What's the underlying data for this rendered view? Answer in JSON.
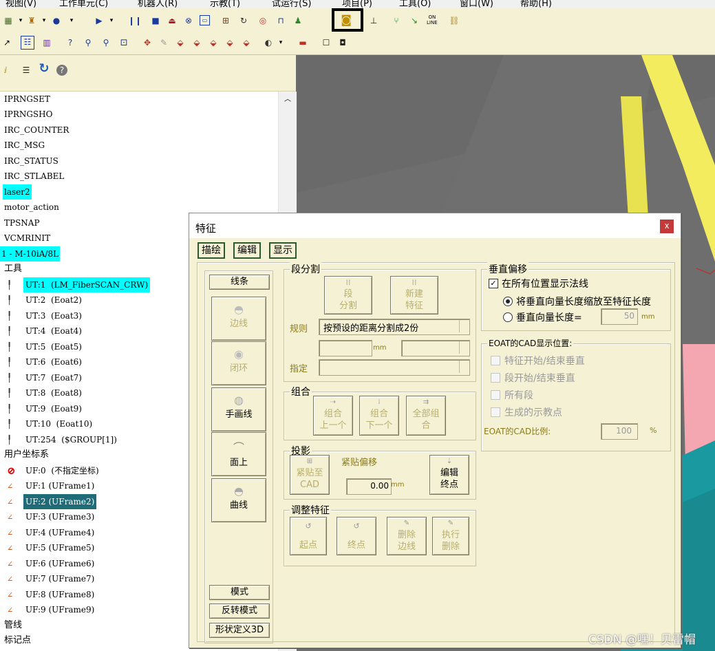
{
  "menubar": {
    "items": [
      "视图(V)",
      "工作单元(C)",
      "机器人(R)",
      "示教(T)",
      "试运行(S)",
      "项目(P)",
      "工具(O)",
      "窗口(W)",
      "帮助(H)"
    ]
  },
  "toolbar": {
    "online_label_1": "ON",
    "online_label_2": "LINE"
  },
  "tree": {
    "items": [
      {
        "text": "IPRNGSET",
        "hl": ""
      },
      {
        "text": "IPRNGSHO",
        "hl": ""
      },
      {
        "text": "IRC_COUNTER",
        "hl": ""
      },
      {
        "text": "IRC_MSG",
        "hl": ""
      },
      {
        "text": "IRC_STATUS",
        "hl": ""
      },
      {
        "text": "IRC_STLABEL",
        "hl": ""
      },
      {
        "text": "laser2",
        "hl": "cyan"
      },
      {
        "text": "motor_action",
        "hl": ""
      },
      {
        "text": "TPSNAP",
        "hl": ""
      },
      {
        "text": "VCMRINIT",
        "hl": ""
      },
      {
        "text": "1 - M-10iA/8L",
        "hl": "cyan"
      },
      {
        "text": "工具",
        "hl": ""
      },
      {
        "text": "UT:1  (LM_FiberSCAN_CRW)",
        "hl": "cyan"
      },
      {
        "text": "UT:2  (Eoat2)",
        "hl": ""
      },
      {
        "text": "UT:3  (Eoat3)",
        "hl": ""
      },
      {
        "text": "UT:4  (Eoat4)",
        "hl": ""
      },
      {
        "text": "UT:5  (Eoat5)",
        "hl": ""
      },
      {
        "text": "UT:6  (Eoat6)",
        "hl": ""
      },
      {
        "text": "UT:7  (Eoat7)",
        "hl": ""
      },
      {
        "text": "UT:8  (Eoat8)",
        "hl": ""
      },
      {
        "text": "UT:9  (Eoat9)",
        "hl": ""
      },
      {
        "text": "UT:10  (Eoat10)",
        "hl": ""
      },
      {
        "text": "UT:254  ($GROUP[1])",
        "hl": ""
      },
      {
        "text": "用户坐标系",
        "hl": ""
      },
      {
        "text": "UF:0  (不指定坐标)",
        "hl": ""
      },
      {
        "text": "UF:1 (UFrame1)",
        "hl": ""
      },
      {
        "text": "UF:2 (UFrame2)",
        "hl": "teal"
      },
      {
        "text": "UF:3 (UFrame3)",
        "hl": ""
      },
      {
        "text": "UF:4 (UFrame4)",
        "hl": ""
      },
      {
        "text": "UF:5 (UFrame5)",
        "hl": ""
      },
      {
        "text": "UF:6 (UFrame6)",
        "hl": ""
      },
      {
        "text": "UF:7 (UFrame7)",
        "hl": ""
      },
      {
        "text": "UF:8 (UFrame8)",
        "hl": ""
      },
      {
        "text": "UF:9 (UFrame9)",
        "hl": ""
      },
      {
        "text": "管线",
        "hl": ""
      },
      {
        "text": "标记点",
        "hl": ""
      }
    ]
  },
  "dialog": {
    "title": "特征",
    "close": "x",
    "tabs": [
      "描绘",
      "编辑",
      "显示"
    ],
    "left_buttons": {
      "line": "线条",
      "edge": "边线",
      "loop": "闭环",
      "freehand": "手画线",
      "surface": "面上",
      "curve": "曲线",
      "mode": "模式",
      "reverse_mode": "反转模式",
      "shape_3d": "形状定义3D"
    },
    "segment_group": {
      "label": "段分割",
      "split_btn_1": "段",
      "split_btn_2": "分割",
      "new_feature_1": "新建",
      "new_feature_2": "特征",
      "rule_label": "规则",
      "rule_value": "按预设的距离分割成2份",
      "mm_unit": "mm",
      "specify_label": "指定"
    },
    "combine_group": {
      "label": "组合",
      "prev_1": "组合",
      "prev_2": "上一个",
      "next_1": "组合",
      "next_2": "下一个",
      "all_1": "全部组",
      "all_2": "合"
    },
    "projection_group": {
      "label": "投影",
      "snap_1": "紧贴至",
      "snap_2": "CAD",
      "offset_label": "紧贴偏移",
      "offset_value": "0.00",
      "mm_unit": "mm",
      "edit_end_1": "编辑",
      "edit_end_2": "终点"
    },
    "adjust_group": {
      "label": "调整特征",
      "start": "起点",
      "end": "终点",
      "del_edge_1": "删除",
      "del_edge_2": "边线",
      "exec_del_1": "执行",
      "exec_del_2": "删除"
    },
    "vertical_group": {
      "label": "垂直偏移",
      "show_normal": "在所有位置显示法线",
      "scale_option": "将垂直向量长度缩放至特征长度",
      "length_option": "垂直向量长度=",
      "length_value": "50",
      "mm_unit": "mm"
    },
    "eoat_group": {
      "label": "EOAT的CAD显示位置:",
      "opt1": "特征开始/结束垂直",
      "opt2": "段开始/结束垂直",
      "opt3": "所有段",
      "opt4": "生成的示教点",
      "scale_label": "EOAT的CAD比例:",
      "scale_value": "100",
      "pct": "%"
    }
  },
  "watermark": "CSDN @嘿！贝雷帽",
  "colors": {
    "panel_bg": "#f5f1d4",
    "highlight_cyan": "#00ffff",
    "highlight_teal": "#1f6b78",
    "viewport_yellow": "#f2ec5e",
    "viewport_gray": "#6e6e6e",
    "close_red": "#c33a3a"
  }
}
